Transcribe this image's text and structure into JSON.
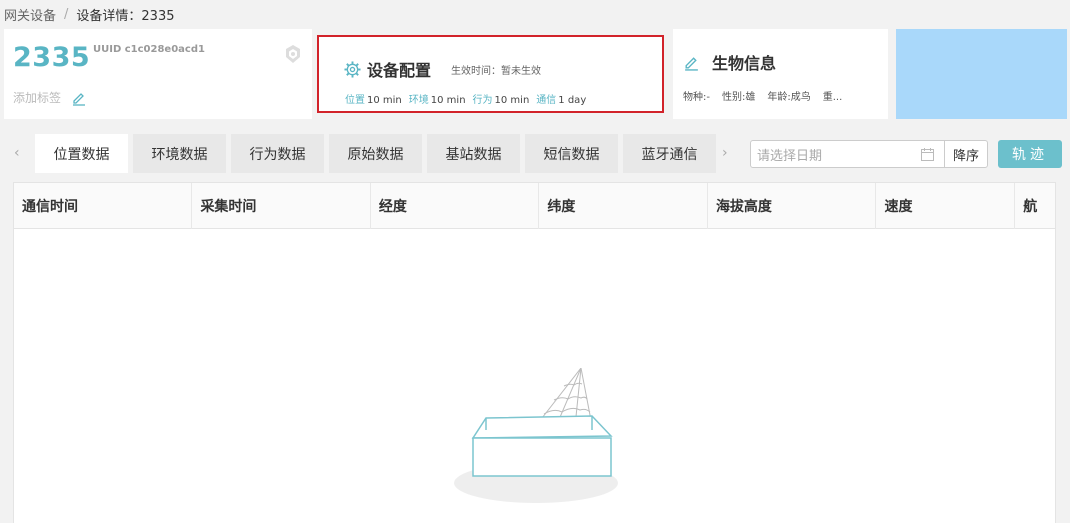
{
  "breadcrumb": {
    "parent": "网关设备",
    "separator": "/",
    "current": "设备详情：2335"
  },
  "device": {
    "id": "2335",
    "uuid": "UUID c1c028e0acd1",
    "add_tag": "添加标签"
  },
  "config": {
    "title": "设备配置",
    "effective": "生效时间：暂未生效",
    "items": [
      {
        "key": "位置",
        "value": "10 min"
      },
      {
        "key": "环境",
        "value": "10 min"
      },
      {
        "key": "行为",
        "value": "10 min"
      },
      {
        "key": "通信",
        "value": "1 day"
      }
    ]
  },
  "bio": {
    "title": "生物信息",
    "fields": [
      "物种:-",
      "性别:雄",
      "年龄:成鸟",
      "重..."
    ]
  },
  "tabs": [
    "位置数据",
    "环境数据",
    "行为数据",
    "原始数据",
    "基站数据",
    "短信数据",
    "蓝牙通信"
  ],
  "toolbar": {
    "date_placeholder": "请选择日期",
    "sort_label": "降序",
    "track_label": "轨迹"
  },
  "table": {
    "columns": [
      "通信时间",
      "采集时间",
      "经度",
      "纬度",
      "海拔高度",
      "速度",
      "航"
    ]
  },
  "colors": {
    "accent": "#59b5c4",
    "highlight_border": "#d2232a",
    "blue_panel": "#a9d8fa",
    "track_button": "#6cc0cc"
  }
}
